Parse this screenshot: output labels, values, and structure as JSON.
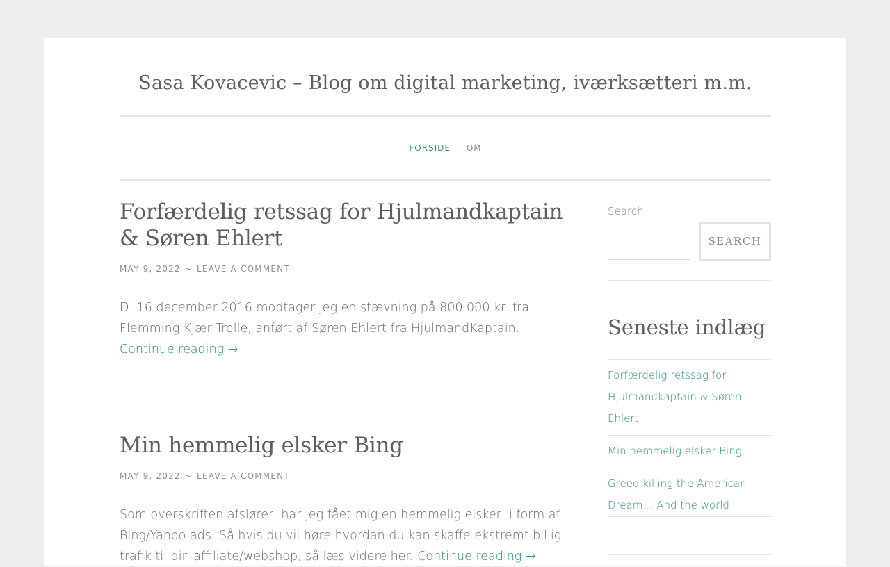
{
  "site": {
    "title": "Sasa Kovacevic – Blog om digital marketing, iværksætteri m.m."
  },
  "nav": {
    "items": [
      {
        "label": "Forside",
        "active": true
      },
      {
        "label": "Om",
        "active": false
      }
    ]
  },
  "posts": [
    {
      "title": "Forfærdelig retssag for Hjulmandkaptain & Søren Ehlert",
      "date": "May 9, 2022",
      "separator": "~",
      "comment_link": "Leave a comment",
      "excerpt": "D. 16 december 2016 modtager jeg en stævning på 800.000 kr. fra Flemming Kjær Trolle, anført af Søren Ehlert fra HjulmandKaptain.",
      "more_label": "Continue reading →"
    },
    {
      "title": "Min hemmelig elsker Bing",
      "date": "May 9, 2022",
      "separator": "~",
      "comment_link": "Leave a comment",
      "excerpt": "Som overskriften afslører, har jeg fået mig en hemmelig elsker, i form af Bing/Yahoo ads. Så hvis du vil høre hvordan du kan skaffe ekstremt billig trafik til din affiliate/webshop, så læs videre her.",
      "more_label": "Continue reading →"
    }
  ],
  "sidebar": {
    "search_label": "Search",
    "search_button": "Search",
    "recent_title": "Seneste indlæg",
    "recent_posts": [
      "Forfærdelig retssag for Hjulmandkaptain & Søren Ehlert",
      "Min hemmelig elsker Bing",
      "Greed killing the American Dream… And the world"
    ]
  },
  "colors": {
    "accent": "#2f8a8a",
    "background": "#ededed"
  }
}
